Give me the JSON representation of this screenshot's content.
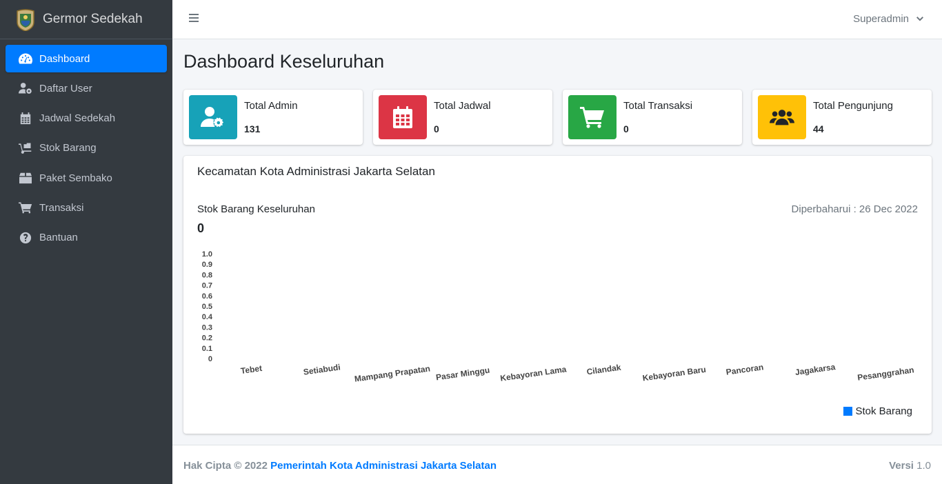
{
  "brand": {
    "name": "Germor Sedekah",
    "logo_icon": "emblem-logo"
  },
  "sidebar": {
    "items": [
      {
        "label": "Dashboard",
        "icon": "tachometer-icon",
        "active": true
      },
      {
        "label": "Daftar User",
        "icon": "user-cog-icon",
        "active": false
      },
      {
        "label": "Jadwal Sedekah",
        "icon": "calendar-icon",
        "active": false
      },
      {
        "label": "Stok Barang",
        "icon": "dolly-icon",
        "active": false
      },
      {
        "label": "Paket Sembako",
        "icon": "box-icon",
        "active": false
      },
      {
        "label": "Transaksi",
        "icon": "cart-icon",
        "active": false
      },
      {
        "label": "Bantuan",
        "icon": "question-circle-icon",
        "active": false
      }
    ]
  },
  "topbar": {
    "user": "Superadmin"
  },
  "page": {
    "title": "Dashboard Keseluruhan"
  },
  "info_boxes": [
    {
      "label": "Total Admin",
      "value": "131",
      "color": "#17a2b8",
      "icon": "user-cog-icon"
    },
    {
      "label": "Total Jadwal",
      "value": "0",
      "color": "#dc3545",
      "icon": "calendar-icon"
    },
    {
      "label": "Total Transaksi",
      "value": "0",
      "color": "#28a745",
      "icon": "cart-icon"
    },
    {
      "label": "Total Pengunjung",
      "value": "44",
      "color": "#ffc107",
      "icon": "users-icon"
    }
  ],
  "card": {
    "title": "Kecamatan Kota Administrasi Jakarta Selatan",
    "subtitle": "Stok Barang Keseluruhan",
    "updated": "Diperbaharui : 26 Dec 2022",
    "total": "0"
  },
  "chart_data": {
    "type": "bar",
    "categories": [
      "Tebet",
      "Setiabudi",
      "Mampang Prapatan",
      "Pasar Minggu",
      "Kebayoran Lama",
      "Cilandak",
      "Kebayoran Baru",
      "Pancoran",
      "Jagakarsa",
      "Pesanggrahan"
    ],
    "series": [
      {
        "name": "Stok Barang",
        "values": [
          0,
          0,
          0,
          0,
          0,
          0,
          0,
          0,
          0,
          0
        ],
        "color": "#007bff"
      }
    ],
    "yticks": [
      "0",
      "0.1",
      "0.2",
      "0.3",
      "0.4",
      "0.5",
      "0.6",
      "0.7",
      "0.8",
      "0.9",
      "1.0"
    ],
    "ylim": [
      0,
      1
    ],
    "grid": false,
    "legend_position": "bottom-right"
  },
  "footer": {
    "copyright": "Hak Cipta © 2022",
    "org": "Pemerintah Kota Administrasi Jakarta Selatan",
    "version_label": "Versi",
    "version": "1.0"
  }
}
